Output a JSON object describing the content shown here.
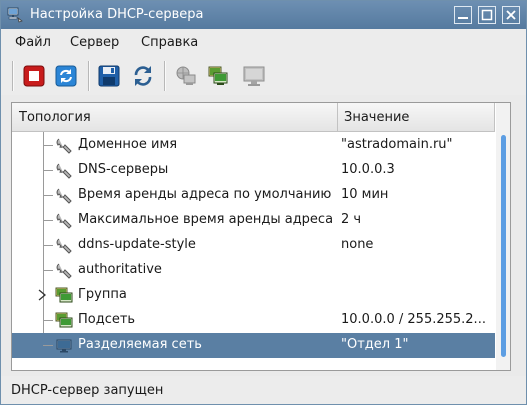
{
  "window": {
    "title": "Настройка DHCP-сервера"
  },
  "menu": [
    "Файл",
    "Сервер",
    "Справка"
  ],
  "toolbar": {
    "buttons": [
      {
        "name": "stop-server-button",
        "icon": "stop-icon",
        "enabled": true
      },
      {
        "name": "restart-server-button",
        "icon": "restart-icon",
        "enabled": true
      },
      {
        "name": "save-button",
        "icon": "save-icon",
        "enabled": true
      },
      {
        "name": "refresh-button",
        "icon": "refresh-icon",
        "enabled": true
      },
      {
        "name": "add-global-button",
        "icon": "network-globe-icon",
        "enabled": false
      },
      {
        "name": "add-group-button",
        "icon": "group-computers-icon",
        "enabled": true
      },
      {
        "name": "add-host-button",
        "icon": "computer-icon",
        "enabled": false
      }
    ]
  },
  "tree": {
    "columns": [
      "Топология",
      "Значение"
    ],
    "rows": [
      {
        "name": "Доменное имя",
        "value": "\"astradomain.ru\"",
        "icon": "wrench-icon",
        "selected": false
      },
      {
        "name": "DNS-серверы",
        "value": "10.0.0.3",
        "icon": "wrench-icon",
        "selected": false
      },
      {
        "name": "Время аренды адреса по умолчанию",
        "value": "10 мин",
        "icon": "wrench-icon",
        "selected": false
      },
      {
        "name": "Максимальное время аренды адреса",
        "value": "2 ч",
        "icon": "wrench-icon",
        "selected": false
      },
      {
        "name": "ddns-update-style",
        "value": "none",
        "icon": "wrench-icon",
        "selected": false
      },
      {
        "name": "authoritative",
        "value": "",
        "icon": "wrench-icon",
        "selected": false
      },
      {
        "name": "Группа",
        "value": "",
        "icon": "group-icon",
        "expandable": true,
        "selected": false
      },
      {
        "name": "Подсеть",
        "value": "10.0.0.0 / 255.255.2...",
        "icon": "subnet-icon",
        "selected": false
      },
      {
        "name": "Разделяемая сеть",
        "value": "\"Отдел 1\"",
        "icon": "shared-network-icon",
        "selected": true
      }
    ]
  },
  "status": {
    "text": "DHCP-сервер запущен"
  },
  "colors": {
    "titlebar": "#5f84a9",
    "selection": "#5a7fa3",
    "scrollbar": "#5d9ee3"
  }
}
